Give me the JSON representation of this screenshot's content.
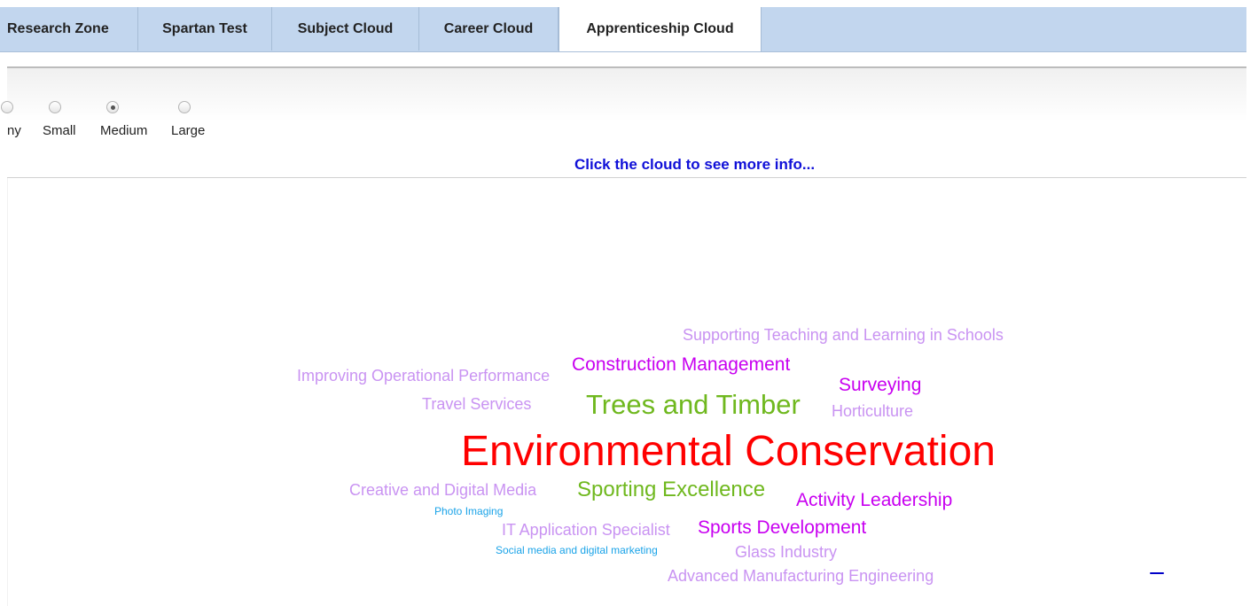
{
  "tabs": [
    {
      "label": "Research Zone"
    },
    {
      "label": "Spartan Test"
    },
    {
      "label": "Subject Cloud"
    },
    {
      "label": "Career Cloud"
    },
    {
      "label": "Apprenticeship Cloud"
    }
  ],
  "size_options": {
    "selected": "Medium",
    "options": [
      {
        "label": "ny"
      },
      {
        "label": "Small"
      },
      {
        "label": "Medium"
      },
      {
        "label": "Large"
      }
    ]
  },
  "hint_text": "Click the cloud to see more info...",
  "cloud": {
    "words": [
      {
        "text": "Supporting Teaching and Learning in Schools",
        "color": "#c993f2"
      },
      {
        "text": "Improving Operational Performance",
        "color": "#c993f2"
      },
      {
        "text": "Construction Management",
        "color": "#c800f0"
      },
      {
        "text": "Surveying",
        "color": "#c800f0"
      },
      {
        "text": "Travel Services",
        "color": "#c993f2"
      },
      {
        "text": "Trees and Timber",
        "color": "#6fb81e"
      },
      {
        "text": "Horticulture",
        "color": "#c993f2"
      },
      {
        "text": "Environmental Conservation",
        "color": "#ff0000"
      },
      {
        "text": "Creative and Digital Media",
        "color": "#c993f2"
      },
      {
        "text": "Sporting Excellence",
        "color": "#6fb81e"
      },
      {
        "text": "Activity Leadership",
        "color": "#c800f0"
      },
      {
        "text": "Photo Imaging",
        "color": "#1aa3e8"
      },
      {
        "text": "IT Application Specialist",
        "color": "#c993f2"
      },
      {
        "text": "Sports Development",
        "color": "#c800f0"
      },
      {
        "text": "Social media and digital marketing",
        "color": "#1aa3e8"
      },
      {
        "text": "Glass Industry",
        "color": "#c993f2"
      },
      {
        "text": "Advanced Manufacturing Engineering",
        "color": "#c993f2"
      }
    ]
  }
}
